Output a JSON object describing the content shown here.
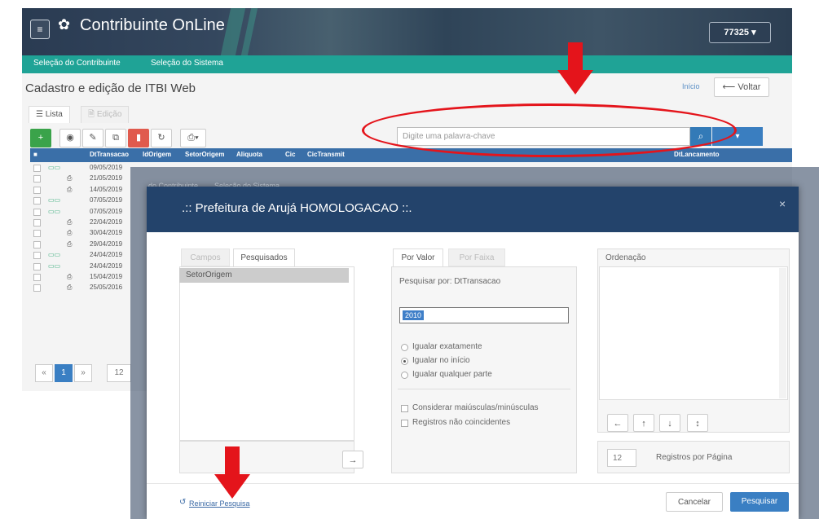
{
  "app": {
    "title": "Contribuinte OnLine",
    "user_code": "77325",
    "nav": [
      "Seleção do Contribuinte",
      "Seleção do Sistema"
    ],
    "page_title": "Cadastro e edição de ITBI Web",
    "breadcrumb_link": "Início",
    "back_label": "Voltar",
    "tabs": [
      "Lista",
      "Edição"
    ],
    "search_placeholder": "Digite uma palavra-chave",
    "grid_headers": [
      "DtTransacao",
      "IdOrigem",
      "SetorOrigem",
      "Aliquota",
      "Cic",
      "CicTransmit",
      "DtLancamento"
    ],
    "rows": [
      {
        "date": "09/05/2019",
        "icon": "doc"
      },
      {
        "date": "21/05/2019",
        "icon": "print"
      },
      {
        "date": "14/05/2019",
        "icon": "print"
      },
      {
        "date": "07/05/2019",
        "icon": "doc"
      },
      {
        "date": "07/05/2019",
        "icon": "doc"
      },
      {
        "date": "22/04/2019",
        "icon": "print"
      },
      {
        "date": "30/04/2019",
        "icon": "print"
      },
      {
        "date": "29/04/2019",
        "icon": "print"
      },
      {
        "date": "24/04/2019",
        "icon": "doc"
      },
      {
        "date": "24/04/2019",
        "icon": "doc"
      },
      {
        "date": "15/04/2019",
        "icon": "print"
      },
      {
        "date": "25/05/2016",
        "icon": "print"
      }
    ],
    "pager": {
      "current": "1",
      "page_size": "12"
    }
  },
  "backdrop": {
    "ghost_nav": [
      "do Contribuinte",
      "Seleção do Sistema"
    ]
  },
  "modal": {
    "title": ".:: Prefeitura de Arujá HOMOLOGACAO ::.",
    "close": "×",
    "left_tabs": [
      "Campos",
      "Pesquisados"
    ],
    "searched_fields": [
      "SetorOrigem"
    ],
    "mid_tabs": [
      "Por Valor",
      "Por Faixa"
    ],
    "search_by_label": "Pesquisar por: DtTransacao",
    "value": "2010",
    "match_options": [
      {
        "label": "Igualar exatamente",
        "selected": false
      },
      {
        "label": "Igualar no início",
        "selected": true
      },
      {
        "label": "Igualar qualquer parte",
        "selected": false
      }
    ],
    "checks": [
      "Considerar maiúsculas/minúsculas",
      "Registros não coincidentes"
    ],
    "order_title": "Ordenação",
    "records_per_page_value": "12",
    "records_per_page_label": "Registros por Página",
    "reset_label": "Reiniciar Pesquisa",
    "cancel_label": "Cancelar",
    "search_label": "Pesquisar"
  },
  "colors": {
    "annotation_red": "#e4141b",
    "header_blue": "#23436b",
    "accent_teal": "#1fa396",
    "primary_blue": "#3a7fc3"
  }
}
